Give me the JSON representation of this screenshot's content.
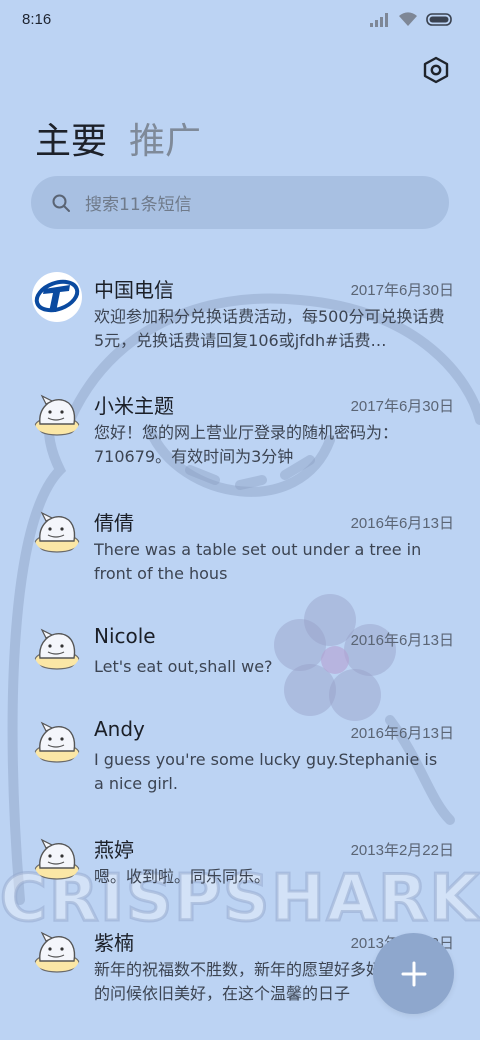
{
  "status_bar": {
    "time": "8:16"
  },
  "tabs": [
    {
      "label": "主要",
      "active": true
    },
    {
      "label": "推广",
      "active": false
    }
  ],
  "search": {
    "placeholder": "搜索11条短信"
  },
  "watermark": "CRISPSHARK",
  "conversations": [
    {
      "name": "中国电信",
      "date": "2017年6月30日",
      "preview": "欢迎参加积分兑换话费活动，每500分可兑换话费5元，兑换话费请回复106或jfdh#话费…",
      "avatar": "china-telecom-logo"
    },
    {
      "name": "小米主题",
      "date": "2017年6月30日",
      "preview": "您好！您的网上营业厅登录的随机密码为：710679。有效时间为3分钟",
      "avatar": "shark-avatar"
    },
    {
      "name": "倩倩",
      "date": "2016年6月13日",
      "preview": "There was a table set out under a tree in front of the hous",
      "avatar": "shark-avatar"
    },
    {
      "name": "Nicole",
      "date": "2016年6月13日",
      "preview": "Let's eat out,shall we?",
      "avatar": "shark-avatar"
    },
    {
      "name": "Andy",
      "date": "2016年6月13日",
      "preview": "I guess you're some lucky guy.Stephanie is a nice girl.",
      "avatar": "shark-avatar"
    },
    {
      "name": "燕婷",
      "date": "2013年2月22日",
      "preview": "嗯。收到啦。同乐同乐。",
      "avatar": "shark-avatar"
    },
    {
      "name": "紫楠",
      "date": "2013年2月22日",
      "preview": "新年的祝福数不胜数，新年的愿望好多好多，新年的问候依旧美好，在这个温馨的日子",
      "avatar": "shark-avatar"
    }
  ],
  "colors": {
    "background": "#bcd3f3",
    "fab": "#8ea7cd",
    "telecom_blue": "#0a4aa0"
  }
}
